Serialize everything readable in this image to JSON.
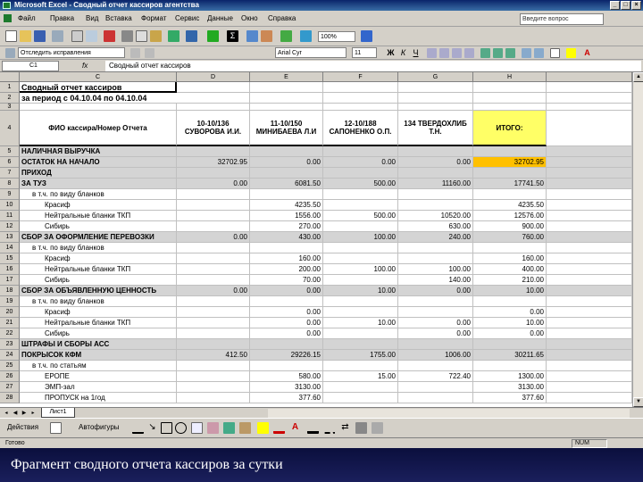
{
  "window": {
    "title": "Microsoft Excel - Сводный отчет кассиров агентства"
  },
  "menu": {
    "items": [
      "Файл",
      "Правка",
      "Вид",
      "Вставка",
      "Формат",
      "Сервис",
      "Данные",
      "Окно",
      "Справка"
    ],
    "help_placeholder": "Введите вопрос"
  },
  "toolbar": {
    "zoom": "100%",
    "font_name": "Arial Cyr",
    "font_size": "11",
    "style_combo": "Отследить исправления"
  },
  "formula": {
    "name_box": "C1",
    "fx": "fx",
    "content": "Сводный отчет кассиров"
  },
  "columns": [
    "C",
    "D",
    "E",
    "F",
    "G",
    "H"
  ],
  "sheet": {
    "title": "Сводный отчет кассиров",
    "period": "за период с 04.10.04 по 04.10.04",
    "header": {
      "name_col": "ФИО кассира/Номер Отчета",
      "cashiers": [
        "10-10/136 СУВОРОВА И.И.",
        "11-10/150 МИНИБАЕВА Л.И",
        "12-10/188 САПОНЕНКО О.П.",
        "134 ТВЕРДОХЛИБ Т.Н."
      ],
      "total": "ИТОГО:"
    },
    "rows": [
      {
        "n": "5",
        "label": "НАЛИЧНАЯ ВЫРУЧКА",
        "vals": [
          "",
          "",
          "",
          "",
          ""
        ],
        "style": "section"
      },
      {
        "n": "6",
        "label": "ОСТАТОК НА НАЧАЛО",
        "vals": [
          "32702.95",
          "0.00",
          "0.00",
          "0.00",
          "32702.95"
        ],
        "style": "section",
        "highlight": true
      },
      {
        "n": "7",
        "label": "ПРИХОД",
        "vals": [
          "",
          "",
          "",
          "",
          ""
        ],
        "style": "section"
      },
      {
        "n": "8",
        "label": "ЗА ТУЗ",
        "vals": [
          "0.00",
          "6081.50",
          "500.00",
          "11160.00",
          "17741.50"
        ],
        "style": "section"
      },
      {
        "n": "9",
        "label": "в т.ч. по виду бланков",
        "vals": [
          "",
          "",
          "",
          "",
          ""
        ],
        "style": "sub"
      },
      {
        "n": "10",
        "label": "Красиф",
        "vals": [
          "",
          "4235.50",
          "",
          "",
          "4235.50"
        ],
        "style": "item"
      },
      {
        "n": "11",
        "label": "Нейтральные бланки ТКП",
        "vals": [
          "",
          "1556.00",
          "500.00",
          "10520.00",
          "12576.00"
        ],
        "style": "item"
      },
      {
        "n": "12",
        "label": "Сибирь",
        "vals": [
          "",
          "270.00",
          "",
          "630.00",
          "900.00"
        ],
        "style": "item"
      },
      {
        "n": "13",
        "label": "СБОР ЗА ОФОРМЛЕНИЕ ПЕРЕВОЗКИ",
        "vals": [
          "0.00",
          "430.00",
          "100.00",
          "240.00",
          "760.00"
        ],
        "style": "section"
      },
      {
        "n": "14",
        "label": "в т.ч. по виду бланков",
        "vals": [
          "",
          "",
          "",
          "",
          ""
        ],
        "style": "sub"
      },
      {
        "n": "15",
        "label": "Красиф",
        "vals": [
          "",
          "160.00",
          "",
          "",
          "160.00"
        ],
        "style": "item"
      },
      {
        "n": "16",
        "label": "Нейтральные бланки ТКП",
        "vals": [
          "",
          "200.00",
          "100.00",
          "100.00",
          "400.00"
        ],
        "style": "item"
      },
      {
        "n": "17",
        "label": "Сибирь",
        "vals": [
          "",
          "70.00",
          "",
          "140.00",
          "210.00"
        ],
        "style": "item"
      },
      {
        "n": "18",
        "label": "СБОР ЗА ОБЪЯВЛЕННУЮ ЦЕННОСТЬ",
        "vals": [
          "0.00",
          "0.00",
          "10.00",
          "0.00",
          "10.00"
        ],
        "style": "section"
      },
      {
        "n": "19",
        "label": "в т.ч. по виду бланков",
        "vals": [
          "",
          "",
          "",
          "",
          ""
        ],
        "style": "sub"
      },
      {
        "n": "20",
        "label": "Красиф",
        "vals": [
          "",
          "0.00",
          "",
          "",
          "0.00"
        ],
        "style": "item"
      },
      {
        "n": "21",
        "label": "Нейтральные бланки ТКП",
        "vals": [
          "",
          "0.00",
          "10.00",
          "0.00",
          "10.00"
        ],
        "style": "item"
      },
      {
        "n": "22",
        "label": "Сибирь",
        "vals": [
          "",
          "0.00",
          "",
          "0.00",
          "0.00"
        ],
        "style": "item"
      },
      {
        "n": "23",
        "label": "ШТРАФЫ И СБОРЫ АСС",
        "vals": [
          "",
          "",
          "",
          "",
          ""
        ],
        "style": "section"
      },
      {
        "n": "24",
        "label": "ПОКРЫСОК КФМ",
        "vals": [
          "412.50",
          "29226.15",
          "1755.00",
          "1006.00",
          "30211.65"
        ],
        "style": "section"
      },
      {
        "n": "25",
        "label": "в т.ч. по статьям",
        "vals": [
          "",
          "",
          "",
          "",
          ""
        ],
        "style": "sub"
      },
      {
        "n": "26",
        "label": "ЕРОПЕ",
        "vals": [
          "",
          "580.00",
          "15.00",
          "722.40",
          "1300.00"
        ],
        "style": "item"
      },
      {
        "n": "27",
        "label": "ЭМП-зал",
        "vals": [
          "",
          "3130.00",
          "",
          "",
          "3130.00"
        ],
        "style": "item"
      },
      {
        "n": "28",
        "label": "ПРОПУСК на 1год",
        "vals": [
          "",
          "377.60",
          "",
          "",
          "377.60"
        ],
        "style": "item"
      }
    ]
  },
  "sheet_tab": "Лист1",
  "drawbar": {
    "actions": "Действия",
    "autoshapes": "Автофигуры"
  },
  "status": {
    "left": "Готово",
    "num": "NUM"
  },
  "caption": "Фрагмент сводного отчета кассиров за сутки"
}
